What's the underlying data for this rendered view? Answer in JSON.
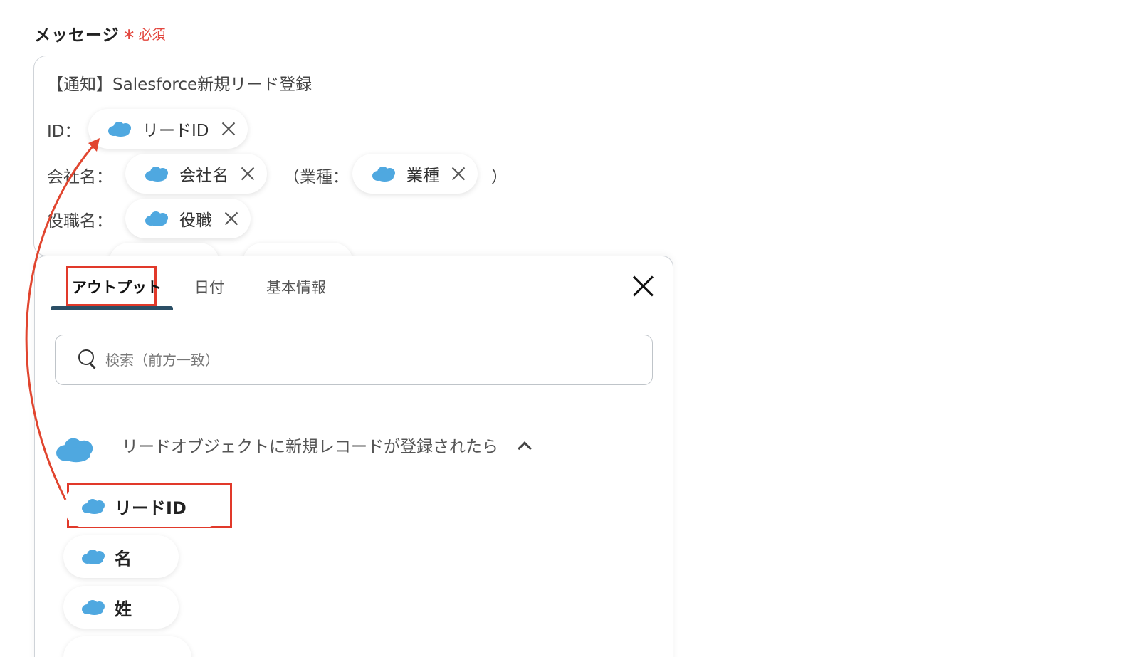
{
  "field": {
    "label": "メッセージ",
    "required_mark": "∗",
    "required_text": "必須"
  },
  "message": {
    "line1": "【通知】Salesforce新規リード登録",
    "id_label": "ID：",
    "company_label": "会社名：",
    "industry_open": "（業種：",
    "industry_close": "）",
    "title_label": "役職名：",
    "chips": {
      "lead_id": "リードID",
      "company": "会社名",
      "industry": "業種",
      "position": "役職"
    }
  },
  "panel": {
    "tabs": [
      {
        "label": "アウトプット"
      },
      {
        "label": "日付"
      },
      {
        "label": "基本情報"
      }
    ],
    "search_placeholder": "検索（前方一致）",
    "section_title": "リードオブジェクトに新規レコードが登録されたら",
    "items": [
      {
        "label": "リードID"
      },
      {
        "label": "名"
      },
      {
        "label": "姓"
      }
    ]
  },
  "icons": {
    "salesforce": "salesforce-cloud-icon",
    "close": "close-icon",
    "search": "search-icon",
    "chevron": "chevron-up-icon"
  },
  "colors": {
    "salesforce_blue": "#4fa8e0",
    "highlight_red": "#e1392a",
    "required_red": "#e3473f",
    "tab_underline": "#2b4f66"
  }
}
